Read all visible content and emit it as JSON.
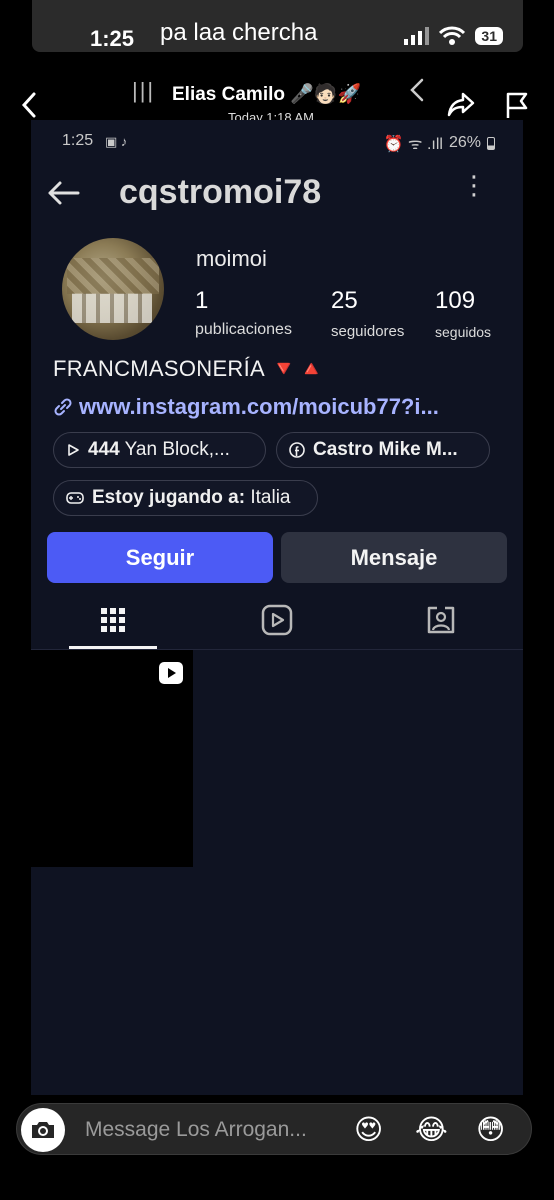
{
  "outer_status": {
    "time": "1:25",
    "caption": "pa laa chercha",
    "battery": "31"
  },
  "story": {
    "menu_glyph": "|||",
    "username": "Elias Camilo 🎤🧑🏻🚀",
    "time": "Today 1:18 AM"
  },
  "inner_status": {
    "time": "1:25",
    "left_icons": "▣ ♪",
    "right_icons": "⏰ ᯤ .ıll",
    "battery": "26%"
  },
  "profile": {
    "username": "cqstromoi78",
    "more_glyph": "⋮",
    "display_name": "moimoi",
    "posts_count": "1",
    "posts_label": "publicaciones",
    "followers_count": "25",
    "followers_label": "seguidores",
    "following_count": "109",
    "following_label": "seguidos",
    "bio": "FRANCMASONERÍA 🔻🔺",
    "link": "www.instagram.com/moicub77?i..."
  },
  "chips": {
    "music_bold": "444",
    "music_rest": " Yan Block,...",
    "facebook": "Castro Mike M...",
    "game_bold": "Estoy jugando a:",
    "game_rest": " Italia"
  },
  "buttons": {
    "follow": "Seguir",
    "message": "Mensaje"
  },
  "tabs": [
    "grid-icon",
    "reels-icon",
    "tagged-icon"
  ],
  "message_bar": {
    "placeholder": "Message Los Arrogan...",
    "emoji_1": "😍",
    "emoji_2": "😂",
    "emoji_3": "😳"
  },
  "colors": {
    "accent": "#4c5bf5",
    "link": "#a7b3ff",
    "profile_bg": "#0f1322"
  }
}
